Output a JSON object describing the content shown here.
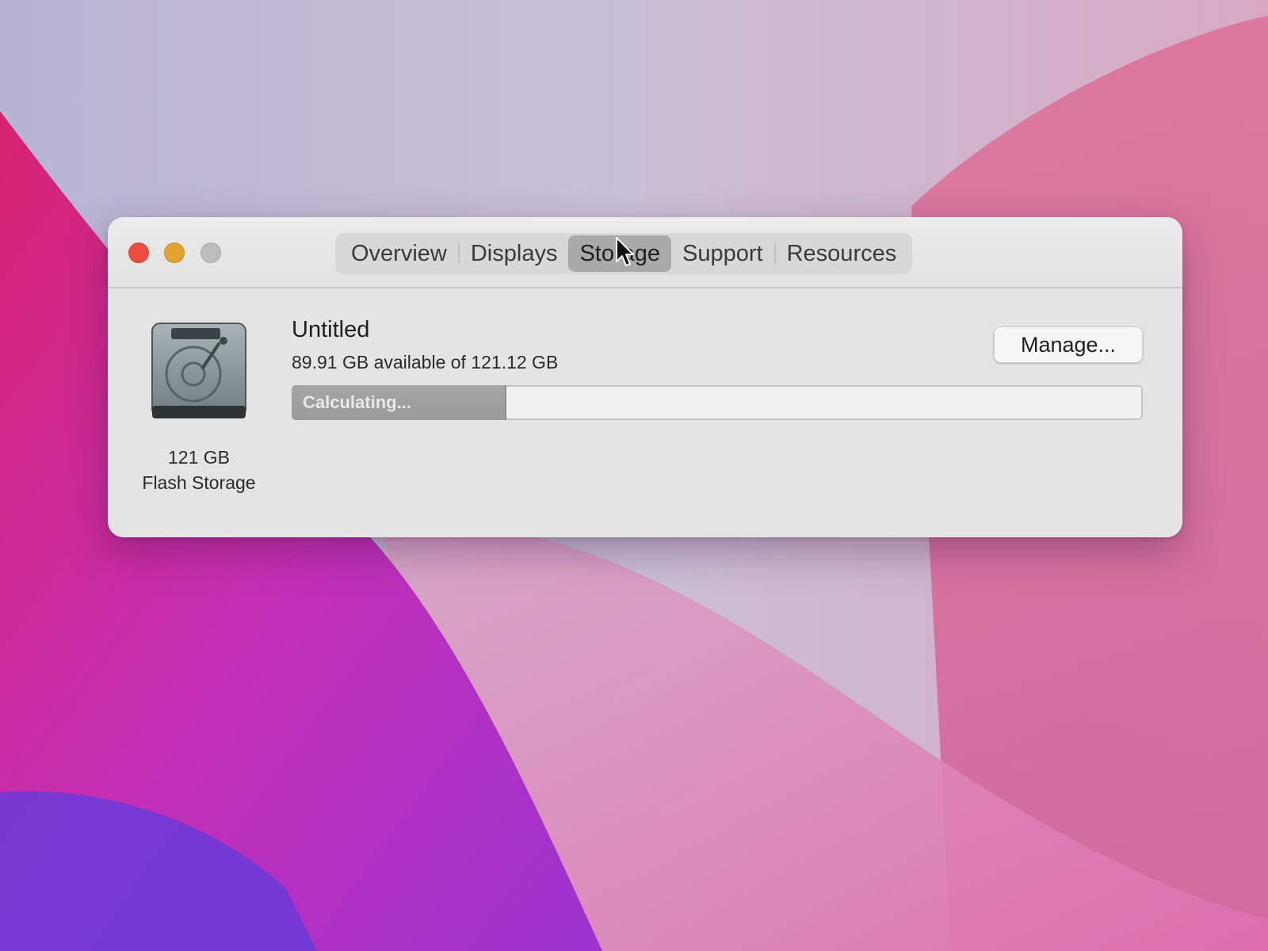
{
  "window": {
    "traffic_lights": {
      "close": "close-icon",
      "minimize": "minimize-icon",
      "zoom": "zoom-icon"
    },
    "tabs": [
      {
        "label": "Overview",
        "active": false
      },
      {
        "label": "Displays",
        "active": false
      },
      {
        "label": "Storage",
        "active": true
      },
      {
        "label": "Support",
        "active": false
      },
      {
        "label": "Resources",
        "active": false
      }
    ]
  },
  "drive": {
    "icon": "hard-drive-icon",
    "size": "121 GB",
    "type": "Flash Storage"
  },
  "volume": {
    "name": "Untitled",
    "available": "89.91 GB available of 121.12 GB",
    "used_fraction": 0.25,
    "status": "Calculating..."
  },
  "manage_button": {
    "label": "Manage..."
  },
  "colors": {
    "close": "#ee4a3f",
    "minimize": "#e4a233",
    "zoom": "#bdbdbd",
    "active_tab": "#a9a9a9",
    "bar_fill": "#a0a0a0"
  }
}
